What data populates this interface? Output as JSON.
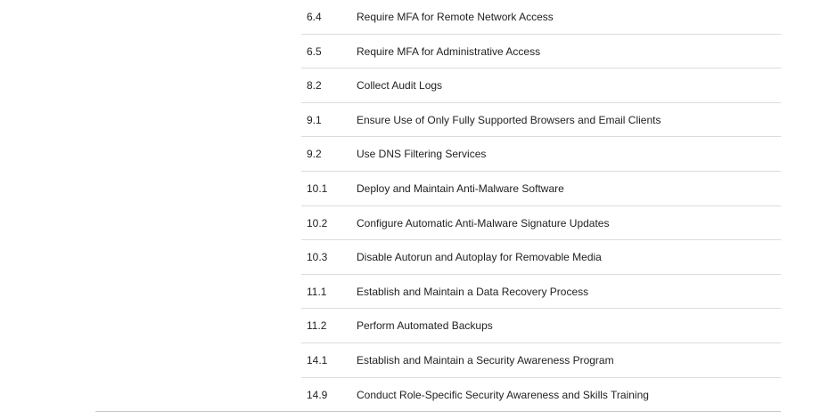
{
  "safeguards": [
    {
      "id": "6.4",
      "title": "Require MFA for Remote Network Access"
    },
    {
      "id": "6.5",
      "title": "Require MFA for Administrative Access"
    },
    {
      "id": "8.2",
      "title": "Collect Audit Logs"
    },
    {
      "id": "9.1",
      "title": "Ensure Use of Only Fully Supported Browsers and Email Clients"
    },
    {
      "id": "9.2",
      "title": "Use DNS Filtering Services"
    },
    {
      "id": "10.1",
      "title": "Deploy and Maintain Anti-Malware Software"
    },
    {
      "id": "10.2",
      "title": "Configure Automatic Anti-Malware Signature Updates"
    },
    {
      "id": "10.3",
      "title": "Disable Autorun and Autoplay for Removable Media"
    },
    {
      "id": "11.1",
      "title": "Establish and Maintain a Data Recovery Process"
    },
    {
      "id": "11.2",
      "title": "Perform Automated Backups"
    },
    {
      "id": "14.1",
      "title": "Establish and Maintain a Security Awareness Program"
    },
    {
      "id": "14.9",
      "title": "Conduct Role-Specific Security Awareness and Skills Training"
    }
  ]
}
